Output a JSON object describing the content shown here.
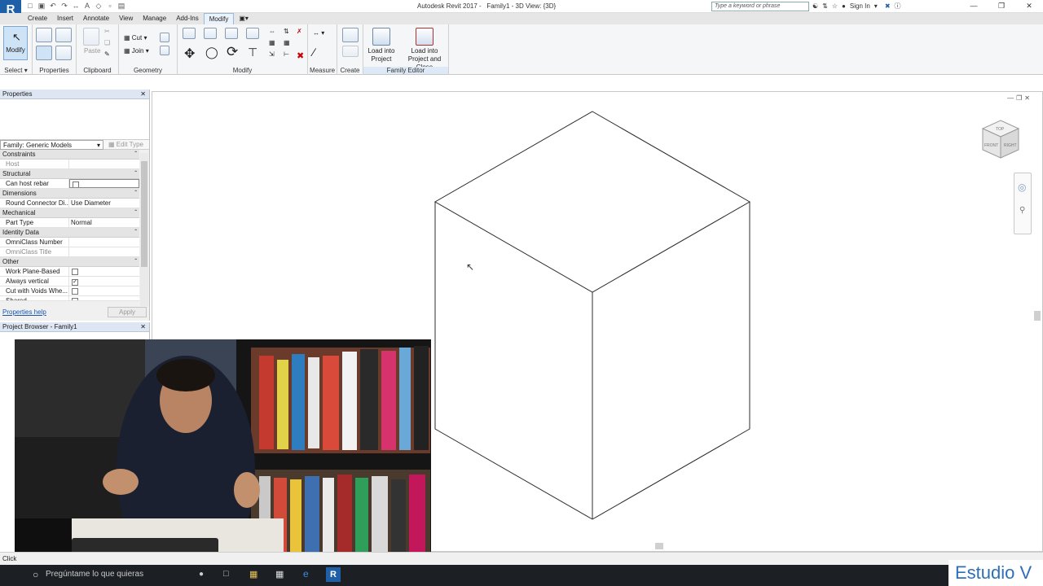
{
  "window": {
    "app_title": "Autodesk Revit 2017 -",
    "doc_title": "Family1 - 3D View: {3D}",
    "search_placeholder": "Type a keyword or phrase",
    "sign_in": "Sign In"
  },
  "tabs": [
    "Create",
    "Insert",
    "Annotate",
    "View",
    "Manage",
    "Add-Ins",
    "Modify"
  ],
  "active_tab": "Modify",
  "ribbon": {
    "modify_label": "Modify",
    "cut_label": "Cut",
    "join_label": "Join",
    "paste_label": "Paste",
    "load_into_project": "Load into\nProject",
    "load_into_project_and_close": "Load into\nProject and Close",
    "panels": [
      "Select",
      "Properties",
      "Clipboard",
      "Geometry",
      "Modify",
      "Measure",
      "Create",
      "Family Editor"
    ]
  },
  "properties": {
    "title": "Properties",
    "family": "Family: Generic Models",
    "edit_type": "Edit Type",
    "groups": [
      {
        "name": "Constraints",
        "rows": [
          {
            "k": "Host",
            "v": "",
            "dim": true
          }
        ]
      },
      {
        "name": "Structural",
        "rows": [
          {
            "k": "Can host rebar",
            "v": "checkbox-off"
          }
        ]
      },
      {
        "name": "Dimensions",
        "rows": [
          {
            "k": "Round Connector Di...",
            "v": "Use Diameter"
          }
        ]
      },
      {
        "name": "Mechanical",
        "rows": [
          {
            "k": "Part Type",
            "v": "Normal"
          }
        ]
      },
      {
        "name": "Identity Data",
        "rows": [
          {
            "k": "OmniClass Number",
            "v": ""
          },
          {
            "k": "OmniClass Title",
            "v": "",
            "dim": true
          }
        ]
      },
      {
        "name": "Other",
        "rows": [
          {
            "k": "Work Plane-Based",
            "v": "checkbox-off"
          },
          {
            "k": "Always vertical",
            "v": "checkbox-on"
          },
          {
            "k": "Cut with Voids Whe...",
            "v": "checkbox-off"
          },
          {
            "k": "Shared",
            "v": "checkbox-off"
          }
        ]
      }
    ],
    "help_link": "Properties help",
    "apply": "Apply"
  },
  "project_browser": {
    "title": "Project Browser - Family1"
  },
  "viewcube": {
    "top": "TOP",
    "front": "FRONT",
    "right": "RIGHT"
  },
  "status_text": "Click",
  "taskbar": {
    "search_placeholder": "Pregúntame lo que quieras"
  },
  "watermark": "Estudio V"
}
